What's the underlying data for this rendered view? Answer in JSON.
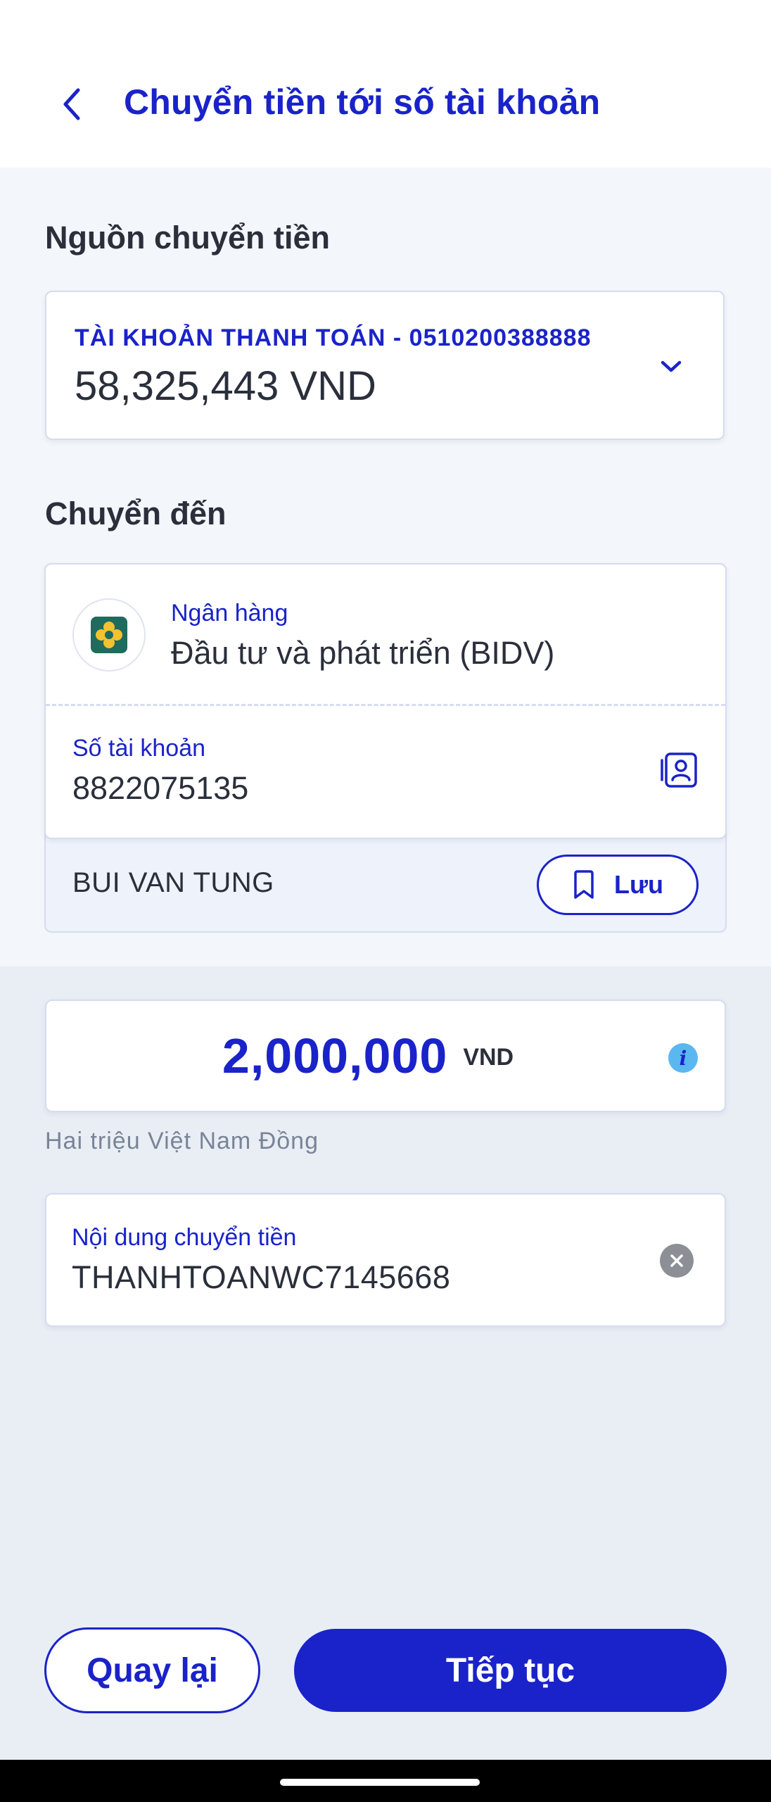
{
  "header": {
    "title": "Chuyển tiền tới số tài khoản"
  },
  "source": {
    "section_label": "Nguồn chuyển tiền",
    "account_label": "TÀI KHOẢN THANH TOÁN - 0510200388888",
    "balance": "58,325,443 VND"
  },
  "destination": {
    "section_label": "Chuyển đến",
    "bank_label": "Ngân hàng",
    "bank_name": "Đầu tư và phát triển (BIDV)",
    "account_label": "Số tài khoản",
    "account_number": "8822075135",
    "recipient_name": "BUI VAN TUNG",
    "save_label": "Lưu"
  },
  "amount": {
    "value": "2,000,000",
    "currency": "VND",
    "in_words": "Hai triệu Việt Nam Đồng"
  },
  "memo": {
    "label": "Nội dung chuyển tiền",
    "value": "THANHTOANWC7145668"
  },
  "actions": {
    "back_label": "Quay lại",
    "next_label": "Tiếp tục"
  },
  "colors": {
    "primary": "#1a23c9",
    "info": "#5ab7f0",
    "text": "#2a2f3b",
    "muted": "#7a8497",
    "bidv_green": "#1f6b5e",
    "bidv_yellow": "#f2c230"
  },
  "icons": {
    "back": "chevron-left-icon",
    "dropdown": "chevron-down-icon",
    "bank_logo": "bidv-logo-icon",
    "contacts": "contact-book-icon",
    "save": "bookmark-icon",
    "info": "info-icon",
    "clear": "clear-icon"
  }
}
